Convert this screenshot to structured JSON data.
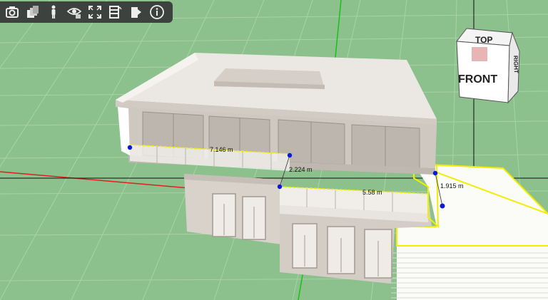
{
  "toolbar": {
    "tools": [
      {
        "name": "screenshot-icon"
      },
      {
        "name": "layers-icon"
      },
      {
        "name": "person-icon"
      },
      {
        "name": "visibility-icon"
      },
      {
        "name": "fullscreen-icon"
      },
      {
        "name": "floors-icon"
      },
      {
        "name": "door-icon"
      },
      {
        "name": "info-icon"
      }
    ]
  },
  "viewcube": {
    "top_label": "TOP",
    "front_label": "FRONT",
    "side_label": "RIGHT"
  },
  "measurements": {
    "upper_length": "7.146 m",
    "height": "2.224 m",
    "lower_length": "5.58 m",
    "depth": "1.915 m"
  },
  "colors": {
    "ground": "#8cc08c",
    "grid_line": "#a9d2a9",
    "axis_x": "#e02020",
    "axis_y": "#19c019",
    "selection": "#f2ee00",
    "point": "#0a1ad8"
  }
}
